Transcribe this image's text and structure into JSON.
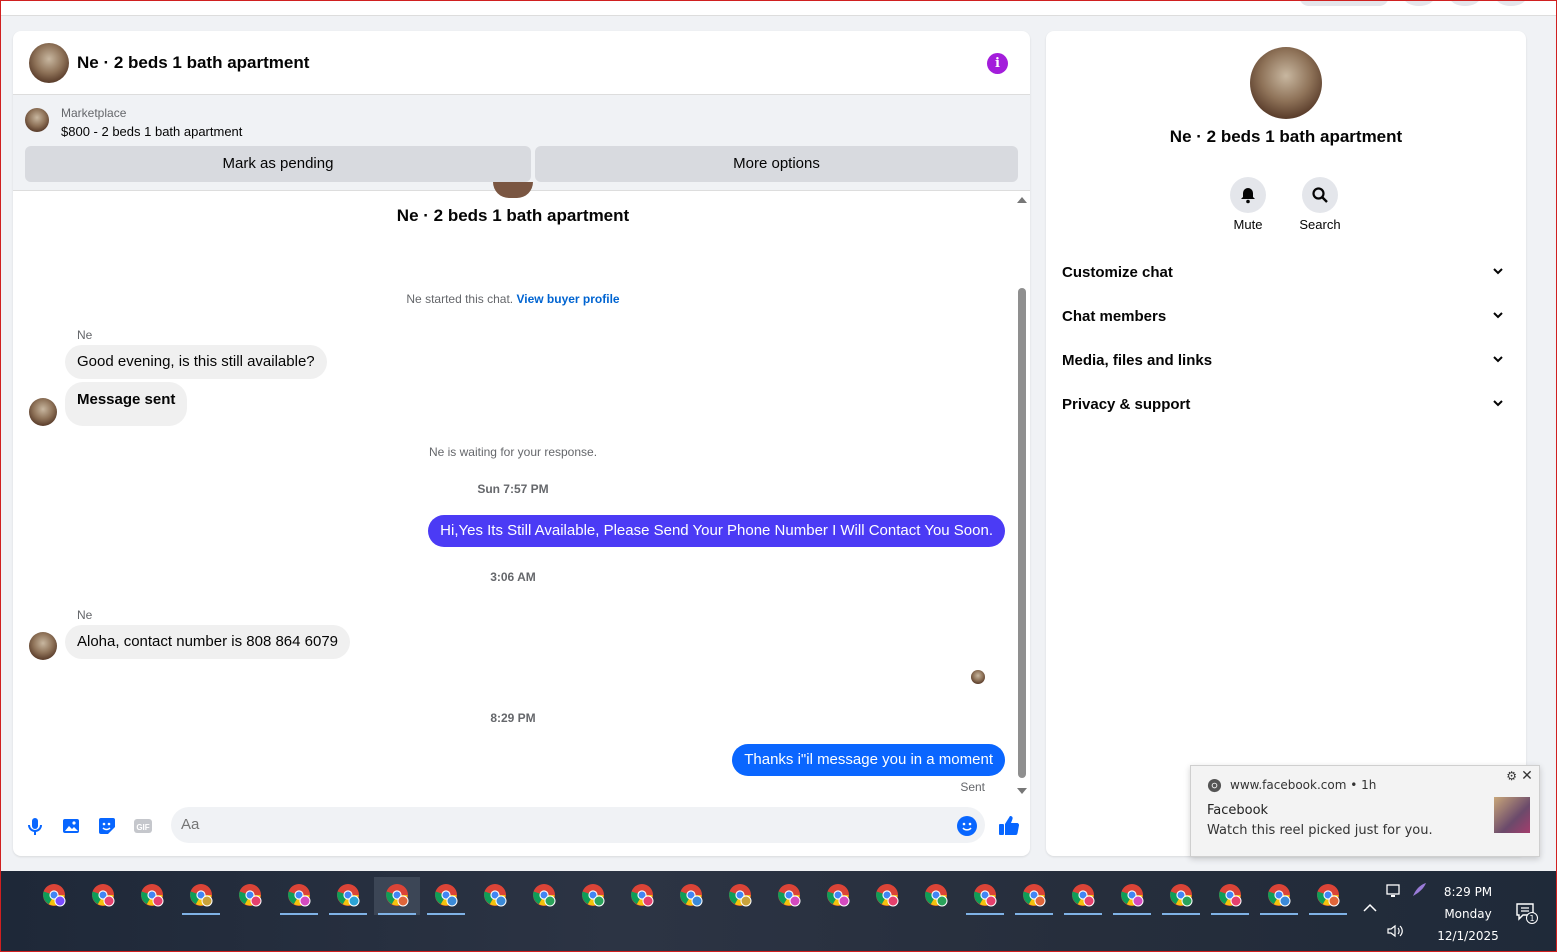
{
  "chat": {
    "title": "Ne · 2 beds 1 bath apartment",
    "marketplace": {
      "label": "Marketplace",
      "listing": "$800 - 2 beds 1 bath apartment",
      "mark_pending_label": "Mark as pending",
      "more_options_label": "More options"
    },
    "conversation_title": "Ne · 2 beds 1 bath apartment",
    "started_text": "Ne started this chat.",
    "buyer_profile_link": "View buyer profile",
    "messages": {
      "sender1": "Ne",
      "msg1": "Good evening, is this still available?",
      "msg2": "Message sent",
      "waiting": "Ne is waiting for your response.",
      "ts1": "Sun 7:57 PM",
      "out1": "Hi,Yes Its Still Available, Please Send Your Phone Number I Will Contact You Soon.",
      "ts2": "3:06 AM",
      "sender2": "Ne",
      "msg3": "Aloha, contact number is 808 864 6079",
      "ts3": "8:29 PM",
      "out2": "Thanks i\"il message you in a moment",
      "sent_label": "Sent"
    },
    "composer": {
      "placeholder": "Aa"
    },
    "colors": {
      "out1": "#4b3bf5",
      "out2": "#0a66ff",
      "accent": "#0866ff",
      "info": "#a31ddb"
    }
  },
  "sidebar": {
    "title": "Ne · 2 beds 1 bath apartment",
    "actions": [
      {
        "label": "Mute",
        "icon": "bell-icon"
      },
      {
        "label": "Search",
        "icon": "search-icon"
      }
    ],
    "sections": [
      {
        "label": "Customize chat"
      },
      {
        "label": "Chat members"
      },
      {
        "label": "Media, files and links"
      },
      {
        "label": "Privacy & support"
      }
    ]
  },
  "notification": {
    "source": "www.facebook.com",
    "age": "1h",
    "title": "Facebook",
    "body": "Watch this reel picked just for you."
  },
  "taskbar": {
    "time": "8:29 PM",
    "day": "Monday",
    "date": "12/1/2025",
    "notification_count": "1"
  }
}
